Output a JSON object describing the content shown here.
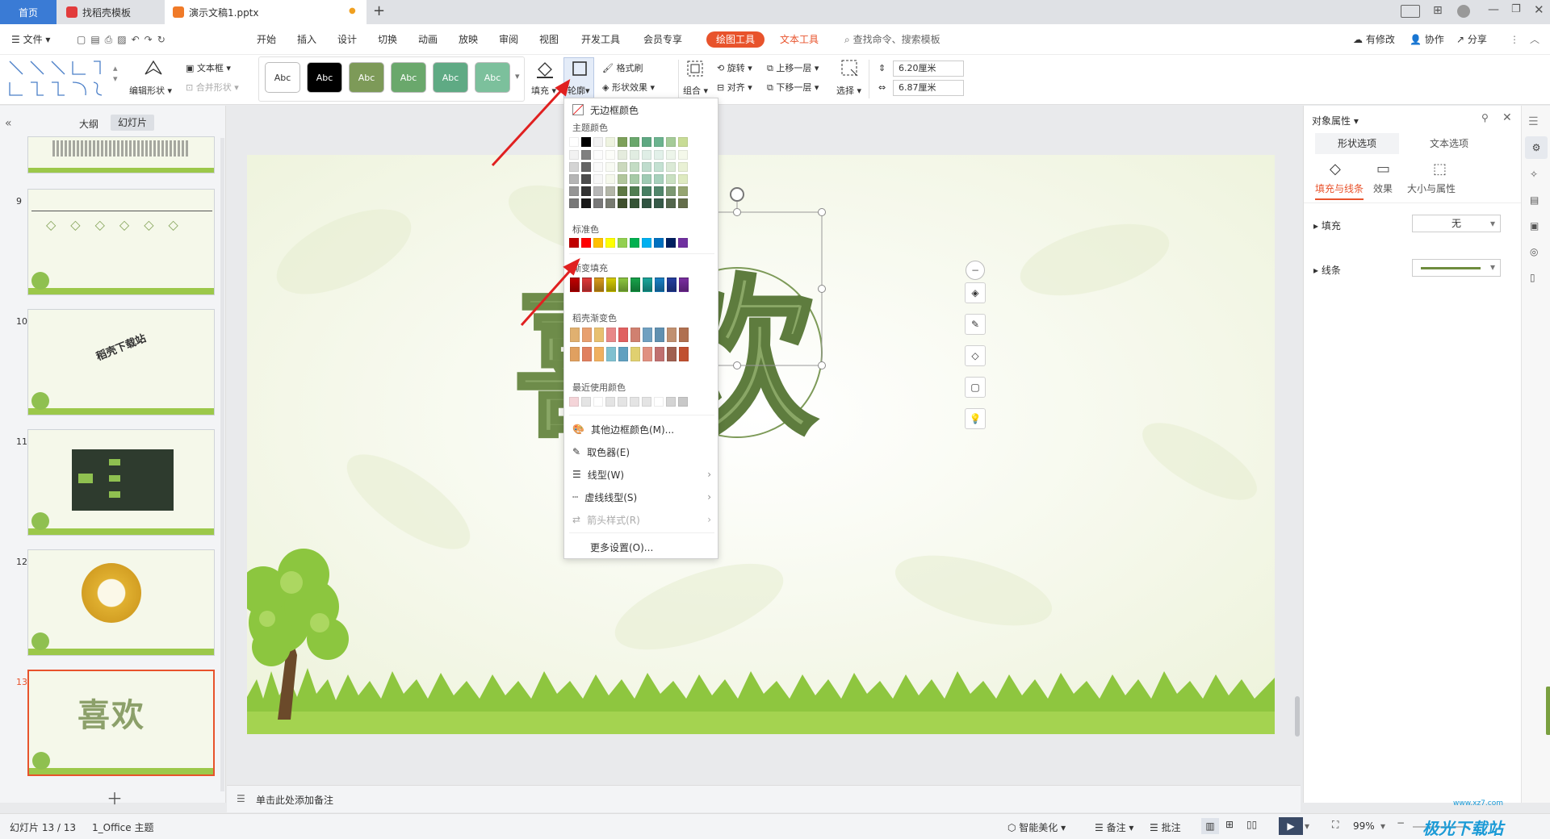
{
  "tabs": {
    "home": "首页",
    "template": "找稻壳模板",
    "doc": "演示文稿1.pptx",
    "add": "+"
  },
  "menu": {
    "file": "文件",
    "items": [
      "开始",
      "插入",
      "设计",
      "切换",
      "动画",
      "放映",
      "审阅",
      "视图",
      "开发工具",
      "会员专享"
    ],
    "drawing_tools": "绘图工具",
    "text_tools": "文本工具",
    "search_placeholder": "查找命令、搜索模板",
    "right": {
      "changes": "有修改",
      "collab": "协作",
      "share": "分享"
    }
  },
  "ribbon": {
    "edit_shape": "编辑形状",
    "textbox": "文本框",
    "merge_shape": "合并形状",
    "style_samples": [
      "Abc",
      "Abc",
      "Abc",
      "Abc",
      "Abc",
      "Abc"
    ],
    "fill": "填充",
    "outline": "轮廓",
    "format_painter": "格式刷",
    "shape_effect": "形状效果",
    "group": "组合",
    "rotate": "旋转",
    "align": "对齐",
    "bring_forward": "上移一层",
    "send_backward": "下移一层",
    "select": "选择",
    "height_value": "6.20厘米",
    "width_value": "6.87厘米"
  },
  "panel_tabs": {
    "outline": "大纲",
    "slides": "幻灯片"
  },
  "thumbnails": [
    {
      "num": "9"
    },
    {
      "num": "10",
      "text": "稻壳下载站"
    },
    {
      "num": "11"
    },
    {
      "num": "12"
    },
    {
      "num": "13",
      "text": "喜欢"
    }
  ],
  "slide": {
    "chars": [
      "喜",
      "欢"
    ]
  },
  "notes_placeholder": "单击此处添加备注",
  "dropdown": {
    "no_border": "无边框颜色",
    "theme_colors": "主题颜色",
    "standard_colors": "标准色",
    "gradient_fill": "渐变填充",
    "docer_gradient": "稻壳渐变色",
    "recent_colors": "最近使用颜色",
    "more_colors": "其他边框颜色(M)...",
    "eyedropper": "取色器(E)",
    "line_type": "线型(W)",
    "dash_type": "虚线线型(S)",
    "arrow_style": "箭头样式(R)",
    "more_settings": "更多设置(O)..."
  },
  "colors": {
    "theme_top": [
      "#ffffff",
      "#000000",
      "#f2f2f2",
      "#eef3e0",
      "#7da05a",
      "#6aa76c",
      "#5fa882",
      "#6cb38f",
      "#a5cb98",
      "#c8dc96"
    ],
    "standard": [
      "#c00000",
      "#ff0000",
      "#ffc000",
      "#ffff00",
      "#92d050",
      "#00b050",
      "#00b0f0",
      "#0070c0",
      "#002060",
      "#7030a0"
    ],
    "gradient": [
      "#c00000",
      "#e03a3a",
      "#d99a1a",
      "#d6cc00",
      "#8cc63f",
      "#17a34a",
      "#1aa59a",
      "#1a7fc4",
      "#243f9e",
      "#7a2ea0"
    ],
    "docer_row1": [
      "#e0b070",
      "#e8a070",
      "#e8c070",
      "#e88888",
      "#e06060",
      "#d08070",
      "#70a0c0",
      "#6090b0",
      "#c09070",
      "#b07050"
    ],
    "docer_row2": [
      "#e0a060",
      "#e08060",
      "#f0b060",
      "#80c0d0",
      "#60a0c0",
      "#e0d070",
      "#e09080",
      "#c07070",
      "#a06050",
      "#c05030"
    ],
    "recent": [
      "#f4d4d8",
      "#e4e4e4",
      "#ffffff",
      "#e4e4e4",
      "#e4e4e4",
      "#e4e4e4",
      "#e4e4e4",
      "#ffffff",
      "#d4d4d4",
      "#c8c8c8"
    ],
    "accent_orange": "#e8532c",
    "shape_green": "#7d9a5a"
  },
  "rightpanel": {
    "title": "对象属性",
    "tab_shape": "形状选项",
    "tab_text": "文本选项",
    "sub_fill_line": "填充与线条",
    "sub_effect": "效果",
    "sub_size": "大小与属性",
    "fill_label": "填充",
    "fill_value": "无",
    "line_label": "线条"
  },
  "status": {
    "slide_info": "幻灯片 13 / 13",
    "theme": "1_Office 主题",
    "beautify": "智能美化",
    "notes": "备注",
    "comment": "批注",
    "zoom": "99%",
    "watermark": "极光下载站",
    "watermark_url": "www.xz7.com"
  }
}
